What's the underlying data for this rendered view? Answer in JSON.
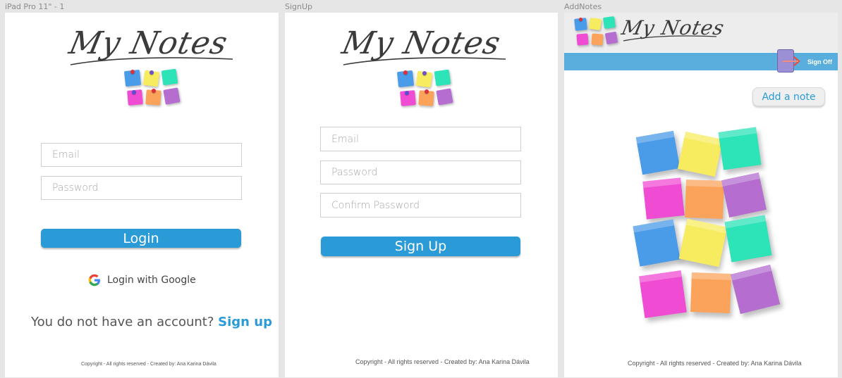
{
  "artboards": [
    {
      "label": "iPad Pro 11\" - 1"
    },
    {
      "label": "SignUp"
    },
    {
      "label": "AddNotes"
    }
  ],
  "logo": {
    "text": "My Notes"
  },
  "login": {
    "email_placeholder": "Email",
    "password_placeholder": "Password",
    "login_button": "Login",
    "google_login": "Login with Google",
    "no_account_text": "You do not have an account?",
    "signup_link": "Sign up",
    "footer": "Copyright - All rights reserved - Created by: Ana Karina Dávila"
  },
  "signup": {
    "email_placeholder": "Email",
    "password_placeholder": "Password",
    "confirm_placeholder": "Confirm Password",
    "signup_button": "Sign Up",
    "footer": "Copyright - All rights reserved - Created by: Ana Karina Dávila"
  },
  "addnotes": {
    "signoff_label": "Sign Off",
    "add_note_button": "Add a note",
    "footer": "Copyright - All rights reserved - Created by: Ana Karina Dávila"
  },
  "colors": {
    "accent": "#2a9bd7",
    "nav_bar": "#5aaede",
    "note_blue": "#4a9be8",
    "note_yellow": "#f7ec5f",
    "note_teal": "#2de3b8",
    "note_pink": "#f04bd3",
    "note_orange": "#fba35b",
    "note_purple": "#b56ed0"
  }
}
